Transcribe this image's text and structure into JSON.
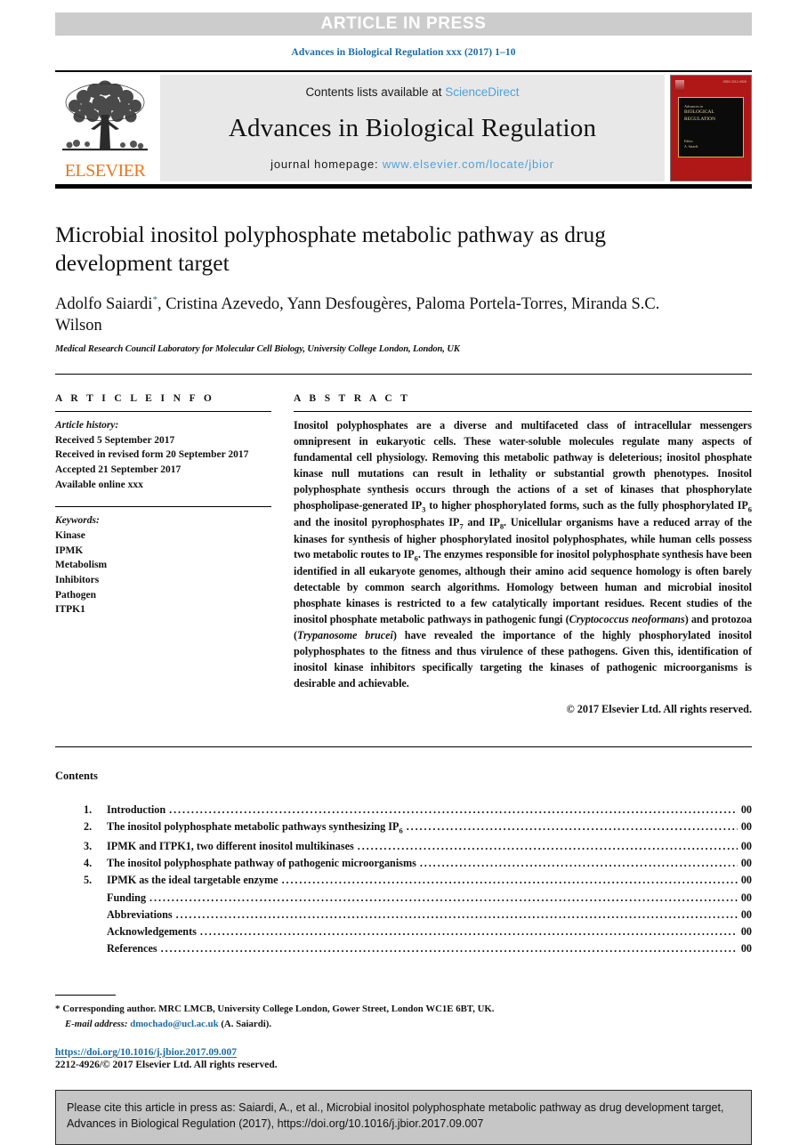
{
  "banner": {
    "label": "ARTICLE IN PRESS"
  },
  "running_head": "Advances in Biological Regulation xxx (2017) 1–10",
  "masthead": {
    "contents_prefix": "Contents lists available at ",
    "sciencedirect": "ScienceDirect",
    "journal_title": "Advances in Biological Regulation",
    "homepage_prefix": "journal homepage: ",
    "homepage_url": "www.elsevier.com/locate/jbior",
    "publisher": "ELSEVIER",
    "cover": {
      "issn": "ISSN 2212-4926",
      "line1": "Advances in",
      "line2": "BIOLOGICAL REGULATION",
      "editor_label": "Editor:",
      "editor_name": "A. Saiardi"
    },
    "colors": {
      "link": "#4aa3df",
      "elsevier_orange": "#e87722",
      "cover_red": "#b01818",
      "cover_gold": "#d6b54a",
      "banner_grey": "#cccccc",
      "masthead_grey": "#e8e8e8"
    }
  },
  "title": "Microbial inositol polyphosphate metabolic pathway as drug development target",
  "authors": {
    "names_before_star": "Adolfo Saiardi",
    "star": "*",
    "names_after_star": ", Cristina Azevedo, Yann Desfougères, Paloma Portela-Torres, Miranda S.C. Wilson"
  },
  "affiliation": "Medical Research Council Laboratory for Molecular Cell Biology, University College London, London, UK",
  "article_info": {
    "heading": "A R T I C L E  I N F O",
    "history_label": "Article history:",
    "history": [
      "Received 5 September 2017",
      "Received in revised form 20 September 2017",
      "Accepted 21 September 2017",
      "Available online xxx"
    ],
    "keywords_label": "Keywords:",
    "keywords": [
      "Kinase",
      "IPMK",
      "Metabolism",
      "Inhibitors",
      "Pathogen",
      "ITPK1"
    ]
  },
  "abstract": {
    "heading": "A B S T R A C T",
    "paragraphs": [
      "Inositol polyphosphates are a diverse and multifaceted class of intracellular messengers omnipresent in eukaryotic cells. These water-soluble molecules regulate many aspects of fundamental cell physiology. Removing this metabolic pathway is deleterious; inositol phosphate kinase null mutations can result in lethality or substantial growth phenotypes. Inositol polyphosphate synthesis occurs through the actions of a set of kinases that phosphorylate phospholipase-generated IP3 to higher phosphorylated forms, such as the fully phosphorylated IP6 and the inositol pyrophosphates IP7 and IP8. Unicellular organisms have a reduced array of the kinases for synthesis of higher phosphorylated inositol polyphosphates, while human cells possess two metabolic routes to IP6. The enzymes responsible for inositol polyphosphate synthesis have been identified in all eukaryote genomes, although their amino acid sequence homology is often barely detectable by common search algorithms. Homology between human and microbial inositol phosphate kinases is restricted to a few catalytically important residues. Recent studies of the inositol phosphate metabolic pathways in pathogenic fungi (Cryptococcus neoformans) and protozoa (Trypanosome brucei) have revealed the importance of the highly phosphorylated inositol polyphosphates to the fitness and thus virulence of these pathogens. Given this, identification of inositol kinase inhibitors specifically targeting the kinases of pathogenic microorganisms is desirable and achievable."
    ],
    "copyright": "© 2017 Elsevier Ltd. All rights reserved."
  },
  "contents": {
    "heading": "Contents",
    "items": [
      {
        "num": "1.",
        "label": "Introduction",
        "page": "00"
      },
      {
        "num": "2.",
        "label": "The inositol polyphosphate metabolic pathways synthesizing IP6",
        "page": "00"
      },
      {
        "num": "3.",
        "label": "IPMK and ITPK1, two different inositol multikinases",
        "page": "00"
      },
      {
        "num": "4.",
        "label": "The inositol polyphosphate pathway of pathogenic microorganisms",
        "page": "00"
      },
      {
        "num": "5.",
        "label": "IPMK as the ideal targetable enzyme",
        "page": "00"
      },
      {
        "num": "",
        "label": "Funding",
        "page": "00"
      },
      {
        "num": "",
        "label": "Abbreviations",
        "page": "00"
      },
      {
        "num": "",
        "label": "Acknowledgements",
        "page": "00"
      },
      {
        "num": "",
        "label": "References",
        "page": "00"
      }
    ]
  },
  "footnotes": {
    "star": "*",
    "corresponding": "Corresponding author. MRC LMCB, University College London, Gower Street, London WC1E 6BT, UK.",
    "email_label": "E-mail address:",
    "email": "dmochado@ucl.ac.uk",
    "email_attrib": "(A. Saiardi).",
    "doi": "https://doi.org/10.1016/j.jbior.2017.09.007",
    "issn_copyright": "2212-4926/© 2017 Elsevier Ltd. All rights reserved."
  },
  "cite_box": {
    "text": "Please cite this article in press as: Saiardi, A., et al., Microbial inositol polyphosphate metabolic pathway as drug development target, Advances in Biological Regulation (2017), https://doi.org/10.1016/j.jbior.2017.09.007"
  }
}
